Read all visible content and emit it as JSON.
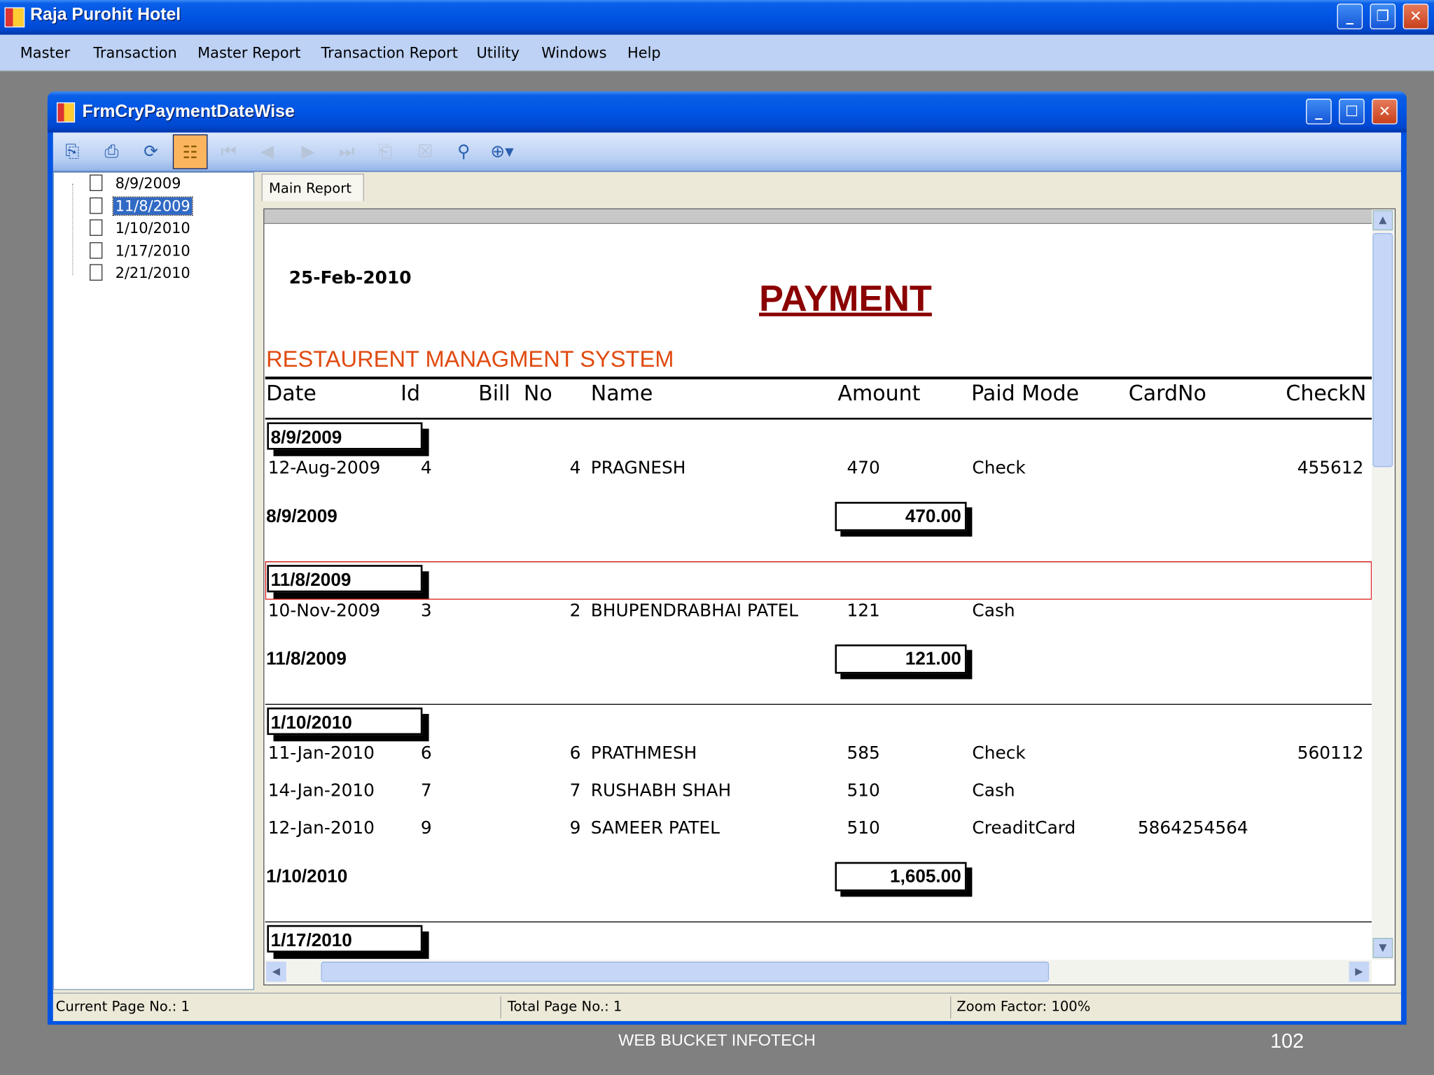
{
  "app": {
    "title": "Raja Purohit Hotel"
  },
  "menu": [
    "Master",
    "Transaction",
    "Master Report",
    "Transaction Report",
    "Utility",
    "Windows",
    "Help"
  ],
  "child": {
    "title": "FrmCryPaymentDateWise"
  },
  "toolbar": {
    "icons": [
      "export-icon",
      "print-icon",
      "refresh-icon",
      "group-tree-toggle-icon",
      "first-page-icon",
      "previous-page-icon",
      "next-page-icon",
      "last-page-icon",
      "goto-page-icon",
      "close-view-icon",
      "find-icon",
      "zoom-icon"
    ]
  },
  "tree": {
    "items": [
      "8/9/2009",
      "11/8/2009",
      "1/10/2010",
      "1/17/2010",
      "2/21/2010"
    ],
    "selected": 1
  },
  "tab": {
    "label": "Main Report"
  },
  "report": {
    "print_date": "25-Feb-2010",
    "title": "PAYMENT",
    "subtitle": "RESTAURENT MANAGMENT SYSTEM",
    "columns": [
      "Date",
      "Id",
      "Bill  No",
      "Name",
      "Amount",
      "Paid Mode",
      "CardNo",
      "CheckN"
    ],
    "groups": [
      {
        "label": "8/9/2009",
        "rows": [
          [
            "12-Aug-2009",
            "4",
            "4",
            "PRAGNESH",
            "470",
            "Check",
            "",
            "455612"
          ]
        ],
        "total": "470.00"
      },
      {
        "label": "11/8/2009",
        "rows": [
          [
            "10-Nov-2009",
            "3",
            "2",
            "BHUPENDRABHAI PATEL",
            "121",
            "Cash",
            "",
            ""
          ]
        ],
        "total": "121.00"
      },
      {
        "label": "1/10/2010",
        "rows": [
          [
            "11-Jan-2010",
            "6",
            "6",
            "PRATHMESH",
            "585",
            "Check",
            "",
            "560112"
          ],
          [
            "14-Jan-2010",
            "7",
            "7",
            "RUSHABH SHAH",
            "510",
            "Cash",
            "",
            ""
          ],
          [
            "12-Jan-2010",
            "9",
            "9",
            "SAMEER PATEL",
            "510",
            "CreaditCard",
            "5864254564",
            ""
          ]
        ],
        "total": "1,605.00"
      },
      {
        "label": "1/17/2010",
        "rows": [],
        "total": null
      }
    ]
  },
  "status": {
    "current_page": "Current Page No.: 1",
    "total_page": "Total Page No.: 1",
    "zoom": "Zoom Factor: 100%"
  },
  "footer": {
    "company": "WEB BUCKET INFOTECH",
    "page_number": "102"
  },
  "colors": {
    "title_red": "#8b0000",
    "subtitle_orange": "#e04a10",
    "selection": "#316ac5"
  }
}
